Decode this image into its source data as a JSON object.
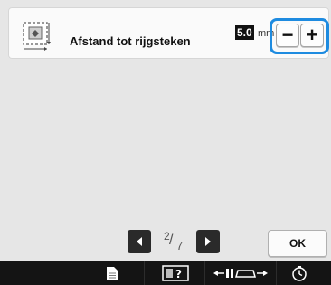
{
  "setting": {
    "label": "Afstand tot rijgsteken",
    "value": "5.0",
    "unit": "mm",
    "minus_label": "−",
    "plus_label": "+",
    "icon": "basting-distance-icon"
  },
  "pager": {
    "current": "2",
    "total": "7",
    "prev_icon": "triangle-left-icon",
    "next_icon": "triangle-right-icon"
  },
  "actions": {
    "ok_label": "OK"
  },
  "bottom_bar": {
    "icons": [
      "document-icon",
      "help-icon",
      "needle-foot-icon",
      "timer-icon"
    ]
  },
  "colors": {
    "highlight": "#1e8be0",
    "background": "#e6e6e6",
    "bar": "#141414"
  }
}
